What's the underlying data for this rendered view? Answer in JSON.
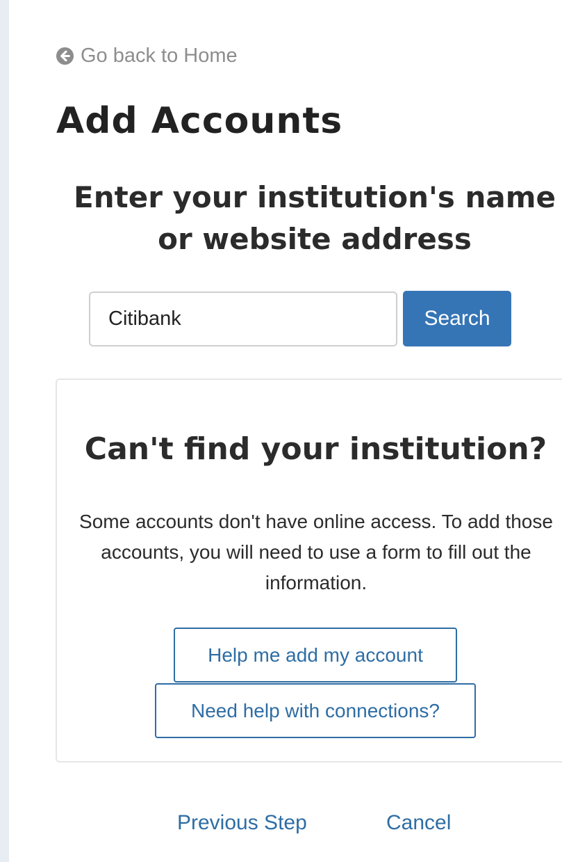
{
  "back_link": {
    "icon": "arrow-circle-left-icon",
    "label": "Go back to Home"
  },
  "page": {
    "title": "Add Accounts"
  },
  "search": {
    "prompt": "Enter your institution's name or website address",
    "value": "Citibank",
    "button_label": "Search"
  },
  "help_panel": {
    "title": "Can't find your institution?",
    "text": "Some accounts don't have online access. To add those accounts, you will need to use a form to fill out the information.",
    "buttons": [
      {
        "label": "Help me add my account"
      },
      {
        "label": "Need help with connections?"
      }
    ]
  },
  "footer": {
    "previous_label": "Previous Step",
    "cancel_label": "Cancel"
  },
  "colors": {
    "primary": "#3575b5",
    "link": "#2e6da4",
    "rail": "#e7edf2",
    "muted_text": "#8d8d8d"
  }
}
